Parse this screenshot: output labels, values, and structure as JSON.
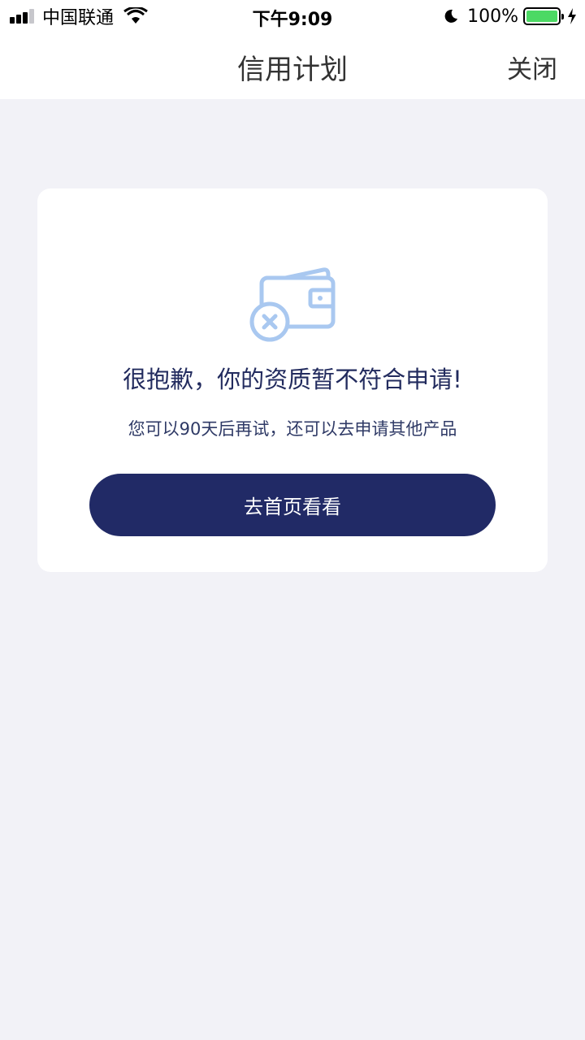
{
  "status_bar": {
    "carrier": "中国联通",
    "time": "下午9:09",
    "battery": "100%",
    "battery_level": 1.0,
    "icons": [
      "signal-icon",
      "wifi-icon",
      "moon-icon",
      "battery-icon",
      "charging-icon"
    ]
  },
  "nav": {
    "title": "信用计划",
    "close_label": "关闭"
  },
  "result": {
    "icon": "wallet-declined-icon",
    "title": "很抱歉，你的资质暂不符合申请!",
    "subtitle": "您可以90天后再试，还可以去申请其他产品",
    "button_label": "去首页看看"
  },
  "colors": {
    "accent": "#212a66",
    "icon": "#a9c8f0",
    "background": "#f2f2f7",
    "battery": "#4cd964"
  }
}
